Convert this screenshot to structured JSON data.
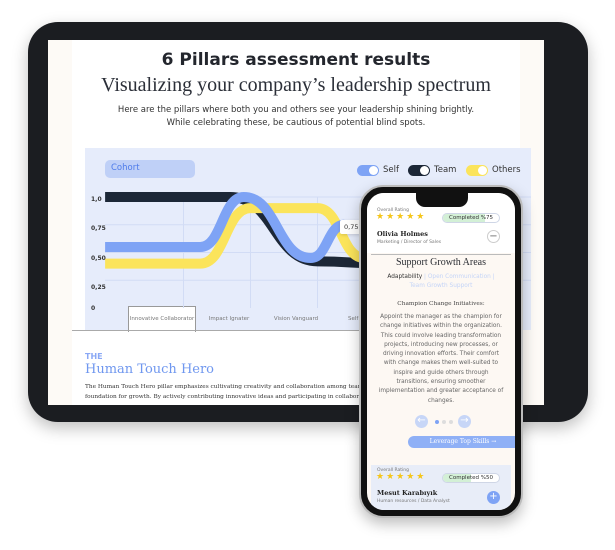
{
  "tablet": {
    "title": "6 Pillars assessment results",
    "subtitle": "Visualizing your company’s leadership spectrum",
    "intro": [
      "Here are the pillars where both you and others see your leadership shining brightly.",
      "While celebrating these, be cautious of potential blind spots."
    ],
    "cohort_label": "Cohort",
    "toggles": [
      {
        "label": "Self",
        "color": "#7ea3f5",
        "on": true
      },
      {
        "label": "Team",
        "color": "#1c2737",
        "on": true
      },
      {
        "label": "Others",
        "color": "#fbe45b",
        "on": true
      }
    ],
    "tooltip": "0,75",
    "section_kicker": "THE",
    "section_title": "Human Touch Hero",
    "section_body": [
      "The Human Touch Hero pillar emphasizes cultivating creativity and collaboration among team me",
      "foundation for growth. By actively contributing innovative ideas and participating in collaborative"
    ]
  },
  "chart_data": {
    "type": "line",
    "categories": [
      "Innovative Collaborator",
      "Impact Ignater",
      "Vision Vanguard",
      "Self Care S"
    ],
    "active_category": "Innovative Collaborator",
    "yticks": [
      "1,0",
      "0,75",
      "0,50",
      "0,25",
      "0"
    ],
    "ylim": [
      0,
      1
    ],
    "grid": true,
    "legend": "top-right",
    "series": [
      {
        "name": "Team",
        "color": "#1c2737",
        "points": [
          [
            -0.67,
            1.0
          ],
          [
            1.2,
            1.0
          ],
          [
            2.5,
            0.42
          ],
          [
            3.5,
            0.4
          ]
        ]
      },
      {
        "name": "Others",
        "color": "#fbe45b",
        "points": [
          [
            -0.67,
            0.4
          ],
          [
            0.75,
            0.4
          ],
          [
            1.5,
            0.9
          ],
          [
            2.5,
            0.9
          ],
          [
            3.2,
            0.45
          ],
          [
            3.5,
            0.45
          ]
        ]
      },
      {
        "name": "Self",
        "color": "#7ea3f5",
        "points": [
          [
            -0.67,
            0.55
          ],
          [
            0.75,
            0.55
          ],
          [
            1.4,
            1.0
          ],
          [
            2.4,
            0.45
          ],
          [
            2.9,
            0.75
          ]
        ]
      }
    ]
  },
  "phone": {
    "card1": {
      "rating_label": "Overall Rating",
      "stars": 5,
      "progress_label": "Completed %75",
      "progress": 0.75,
      "name": "Olivia Holmes",
      "role": "Marketing / Director of Sales",
      "toggle": "−"
    },
    "heading": "Support Growth Areas",
    "tags_active": "Adaptability",
    "tags_rest": " | Open Communication | Team Growth Support",
    "sub_heading": "Champion Change Initiatives:",
    "body": "Appoint the manager as the champion for change initiatives within the organization. This could involve leading transformation projects, introducing new processes, or driving innovation efforts. Their comfort with change makes them well-suited to inspire and guide others through transitions, ensuring smoother implementation and greater acceptance of changes.",
    "prev": "←",
    "next": "→",
    "cta": "Leverage Top Skills →",
    "card2": {
      "rating_label": "Overall Rating",
      "stars": 5,
      "progress_label": "Completed %50",
      "progress": 0.5,
      "name": "Mesut Karabıyık",
      "role": "Human resources / Data Analyst",
      "toggle": "+"
    }
  }
}
